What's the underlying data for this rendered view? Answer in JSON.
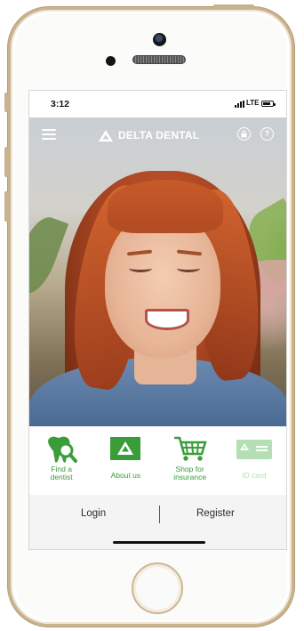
{
  "status_bar": {
    "time": "3:12",
    "network": "LTE"
  },
  "header": {
    "brand": "DELTA DENTAL",
    "menu_icon": "hamburger-icon",
    "lock_icon": "lock-icon",
    "help_icon": "help-icon",
    "help_symbol": "?"
  },
  "actions": [
    {
      "label": "Find a dentist",
      "icon": "tooth-search-icon",
      "enabled": true
    },
    {
      "label": "About us",
      "icon": "delta-logo-icon",
      "enabled": true
    },
    {
      "label": "Shop for insurance",
      "icon": "shopping-cart-icon",
      "enabled": true
    },
    {
      "label": "ID card",
      "icon": "id-card-icon",
      "enabled": false
    }
  ],
  "bottom": {
    "login": "Login",
    "register": "Register"
  },
  "colors": {
    "brand_green": "#3a9d3a",
    "disabled_green": "#b4dfb4",
    "frame_gold": "#c9b48f"
  }
}
